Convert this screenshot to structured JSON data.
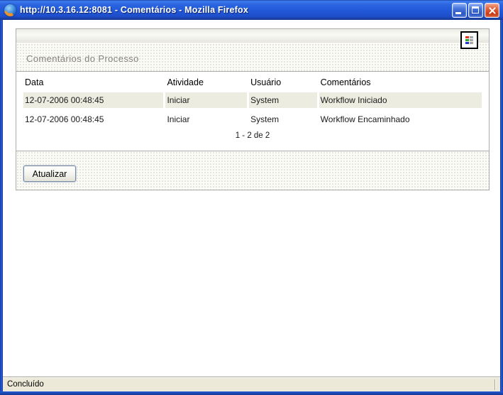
{
  "window": {
    "title": "http://10.3.16.12:8081 - Comentários - Mozilla Firefox"
  },
  "panel": {
    "title": "Comentários do Processo",
    "table": {
      "columns": [
        "Data",
        "Atividade",
        "Usuário",
        "Comentários"
      ],
      "rows": [
        [
          "12-07-2006 00:48:45",
          "Iniciar",
          "System",
          "Workflow Iniciado"
        ],
        [
          "12-07-2006 00:48:45",
          "Iniciar",
          "System",
          "Workflow Encaminhado"
        ]
      ],
      "pagination": "1 - 2 de 2"
    },
    "refresh_button_label": "Atualizar"
  },
  "statusbar": {
    "text": "Concluído"
  },
  "colors": {
    "titlebar_blue": "#2158D8",
    "frame_blue": "#1E50CE",
    "close_red": "#D8552C",
    "row_shade": "#ECECE1",
    "statusbar_bg": "#ECE9D8",
    "panel_title_gray": "#85857D",
    "legend_red": "#E03420",
    "legend_green": "#28A828",
    "legend_blue": "#2038C8"
  }
}
